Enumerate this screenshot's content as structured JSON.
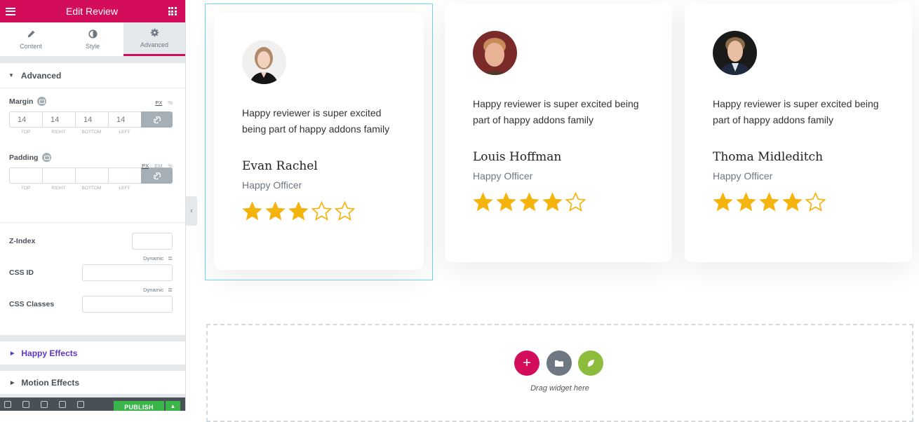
{
  "panel": {
    "title": "Edit Review",
    "tabs": [
      {
        "label": "Content",
        "icon": "pencil-icon"
      },
      {
        "label": "Style",
        "icon": "contrast-icon"
      },
      {
        "label": "Advanced",
        "icon": "gear-icon"
      }
    ],
    "active_tab": "Advanced",
    "advanced_section": "Advanced",
    "margin": {
      "label": "Margin",
      "units": [
        "PX",
        "%"
      ],
      "values": {
        "top": "14",
        "right": "14",
        "bottom": "14",
        "left": "14"
      },
      "sublabels": [
        "TOP",
        "RIGHT",
        "BOTTOM",
        "LEFT"
      ]
    },
    "padding": {
      "label": "Padding",
      "units": [
        "PX",
        "EM",
        "%"
      ],
      "values": {
        "top": "",
        "right": "",
        "bottom": "",
        "left": ""
      },
      "sublabels": [
        "TOP",
        "RIGHT",
        "BOTTOM",
        "LEFT"
      ]
    },
    "zindex_label": "Z-Index",
    "dynamic_label": "Dynamic",
    "css_id_label": "CSS ID",
    "css_classes_label": "CSS Classes",
    "happy_effects": "Happy Effects",
    "motion_effects": "Motion Effects",
    "publish_label": "PUBLISH",
    "accent": "#d30c5c",
    "happy_color": "#5c37c8"
  },
  "reviews": [
    {
      "text_line1": "Happy reviewer is super excited",
      "text_line2": "being part of happy addons family",
      "name": "Evan Rachel",
      "role": "Happy Officer",
      "rating": 3,
      "max": 5
    },
    {
      "text_line1": "Happy reviewer is super excited being",
      "text_line2": "part of happy addons family",
      "name": "Louis Hoffman",
      "role": "Happy Officer",
      "rating": 4,
      "max": 5
    },
    {
      "text_line1": "Happy reviewer is super excited being",
      "text_line2": "part of happy addons family",
      "name": "Thoma Midleditch",
      "role": "Happy Officer",
      "rating": 4,
      "max": 5
    }
  ],
  "star_color": "#f5b30e",
  "dropzone": {
    "text": "Drag widget here"
  }
}
